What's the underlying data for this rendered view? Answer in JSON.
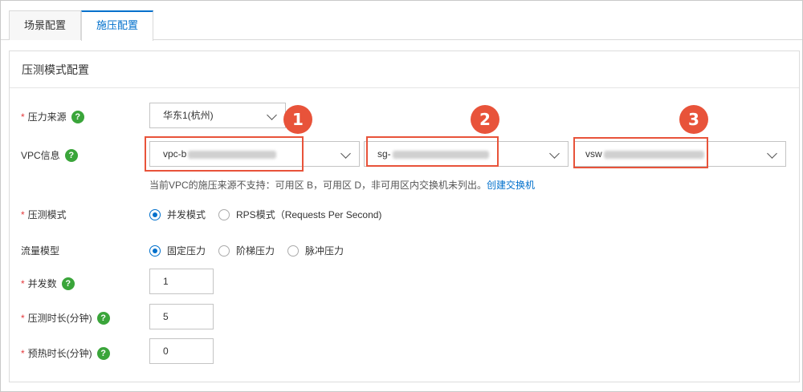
{
  "tabs": [
    {
      "label": "场景配置",
      "active": false
    },
    {
      "label": "施压配置",
      "active": true
    }
  ],
  "panel": {
    "title": "压测模式配置"
  },
  "pressure_source": {
    "label": "压力来源",
    "value": "华东1(杭州)"
  },
  "vpc": {
    "label": "VPC信息",
    "vpc_prefix": "vpc-b",
    "sg_prefix": "sg-",
    "vsw_prefix": "vsw",
    "hint": "当前VPC的施压来源不支持：可用区 B，可用区 D，非可用区内交换机未列出。",
    "hint_link": "创建交换机"
  },
  "badges": [
    "1",
    "2",
    "3"
  ],
  "mode": {
    "label": "压测模式",
    "options": [
      "并发模式",
      "RPS模式（Requests Per Second)"
    ],
    "selected": 0
  },
  "traffic": {
    "label": "流量模型",
    "options": [
      "固定压力",
      "阶梯压力",
      "脉冲压力"
    ],
    "selected": 0
  },
  "concurrency": {
    "label": "并发数",
    "value": "1"
  },
  "duration": {
    "label": "压测时长(分钟)",
    "value": "5"
  },
  "warmup": {
    "label": "预热时长(分钟)",
    "value": "0"
  },
  "colors": {
    "accent": "#0070cc",
    "highlight": "#e8533a",
    "help": "#3aa53a"
  }
}
